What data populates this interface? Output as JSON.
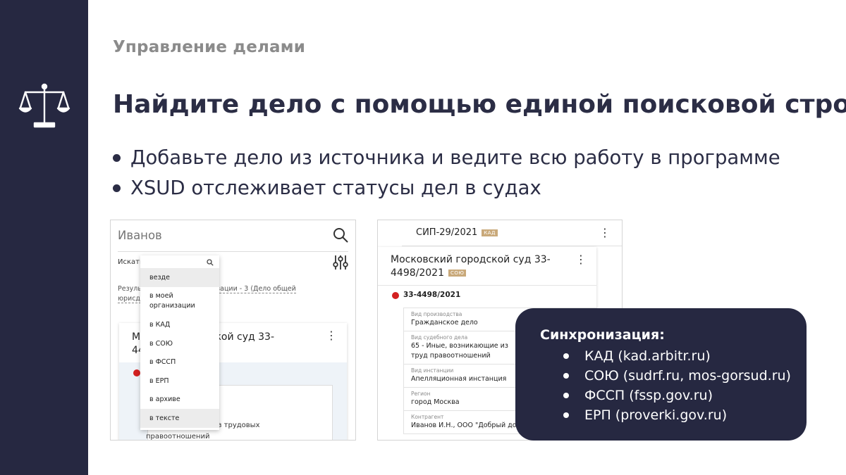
{
  "section_label": "Управление делами",
  "title": "Найдите дело с помощью единой поисковой строки",
  "bullets": [
    "Добавьте дело из источника и ведите всю работу в программе",
    "XSUD отслеживает статусы дел в судах"
  ],
  "left_screenshot": {
    "search_value": "Иванов",
    "search_in_label": "Искать",
    "results_prefix": "Резуль",
    "results_link_1": "изации - 3 (Дело общей",
    "results_link_2": "юрисди",
    "card_title_line1": "М                    дской суд 33-",
    "card_title_line2": "44",
    "card_text_line1": "ющие из трудовых",
    "card_text_line2": "правоотношений",
    "dropdown_options": [
      "везде",
      "в моей организации",
      "в КАД",
      "в СОЮ",
      "в ФССП",
      "в ЕРП",
      "в архиве",
      "в тексте"
    ]
  },
  "right_screenshot": {
    "back_case_no": "СИП-29/2021",
    "back_tag": "КАД",
    "court_line1": "Московский городской суд 33-",
    "court_line2": "4498/2021",
    "court_tag": "СОЮ",
    "case_number": "33-4498/2021",
    "fields": [
      {
        "label": "Вид производства",
        "value": "Гражданское дело"
      },
      {
        "label": "Вид судебного дела",
        "value": "65 - Иные, возникающие из труд правоотношений"
      },
      {
        "label": "Вид инстанции",
        "value": "Апелляционная инстанция"
      },
      {
        "label": "Регион",
        "value": "город Москва"
      },
      {
        "label": "Контрагент",
        "value": "Иванов И.Н., ООО \"Добрый дом\""
      }
    ]
  },
  "sync": {
    "title": "Синхронизация:",
    "items": [
      "КАД (kad.arbitr.ru)",
      "СОЮ (sudrf.ru, mos-gorsud.ru)",
      "ФССП (fssp.gov.ru)",
      "ЕРП (proverki.gov.ru)"
    ]
  },
  "colors": {
    "navy": "#262841",
    "title_text": "#2b2d45",
    "section_label": "#8b8b8b",
    "status_red": "#d32020",
    "tag_tan": "#c9a97a"
  },
  "icons": [
    "scales-of-justice-icon",
    "search-icon",
    "filter-sliders-icon",
    "kebab-menu-icon"
  ]
}
